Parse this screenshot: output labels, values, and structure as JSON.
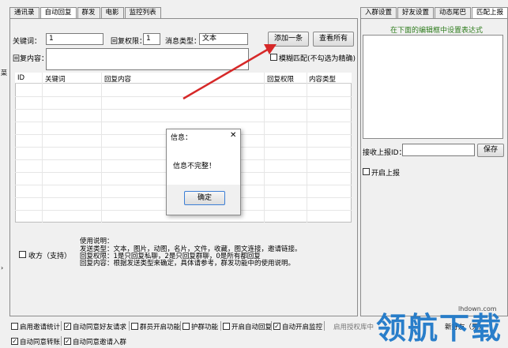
{
  "left_tabs": [
    "通讯录",
    "自动回复",
    "群发",
    "电影",
    "监控列表"
  ],
  "right_tabs": [
    "入群设置",
    "好友设置",
    "动态尾巴",
    "匹配上报"
  ],
  "form": {
    "keyword_label": "关键词：",
    "keyword_value": "1",
    "permission_label": "回复权限：",
    "permission_value": "1",
    "msgtype_label": "消息类型：",
    "msgtype_value": "文本",
    "add_button": "添加一条",
    "view_all_button": "查看所有",
    "content_label": "回复内容：",
    "fuzzy_label": "模糊匹配(不勾选为精确)"
  },
  "table": {
    "columns": [
      "ID",
      "关键词",
      "回复内容",
      "回复权限",
      "内容类型"
    ]
  },
  "dialog": {
    "title": "信息：",
    "close": "✕",
    "message": "信息不完整！",
    "ok_button": "确定"
  },
  "usage": {
    "checkbox_label": "收方（支持）",
    "lines": [
      "使用说明：",
      "发送类型：文本，图片，动图，名片，文件，收藏，图文连接，邀请链接。",
      "回复权限：1是只回复私聊，2是只回复群聊，0是所有都回复",
      "回复内容：根据发送类型来确定，具体请参考，群发功能中的使用说明。"
    ]
  },
  "right_panel": {
    "hint": "在下面的编辑框中设置表达式",
    "receive_label": "接收上报ID：",
    "save_button": "保存",
    "enable_label": "开启上报"
  },
  "bottom_row1": [
    {
      "label": "启用邀请统计",
      "checked": false
    },
    {
      "label": "自动同意好友请求",
      "checked": true
    },
    {
      "label": "群员开启功能",
      "checked": false
    },
    {
      "label": "护群功能",
      "checked": false
    },
    {
      "label": "开启自动回复",
      "checked": false
    },
    {
      "label": "自动开启监控",
      "checked": true
    }
  ],
  "bottom_row1_right": "启用授权库中",
  "bottom_row1_far": "新好友（无）",
  "bottom_row2": [
    {
      "label": "自动同意转账",
      "checked": true
    },
    {
      "label": "自动同意邀请入群",
      "checked": true
    }
  ],
  "side_char": "菜",
  "watermark": {
    "brand": "领航下载",
    "site": "lhdown.com"
  },
  "colors": {
    "hint_green": "#2f7d1e",
    "arrow_red": "#d62828"
  }
}
